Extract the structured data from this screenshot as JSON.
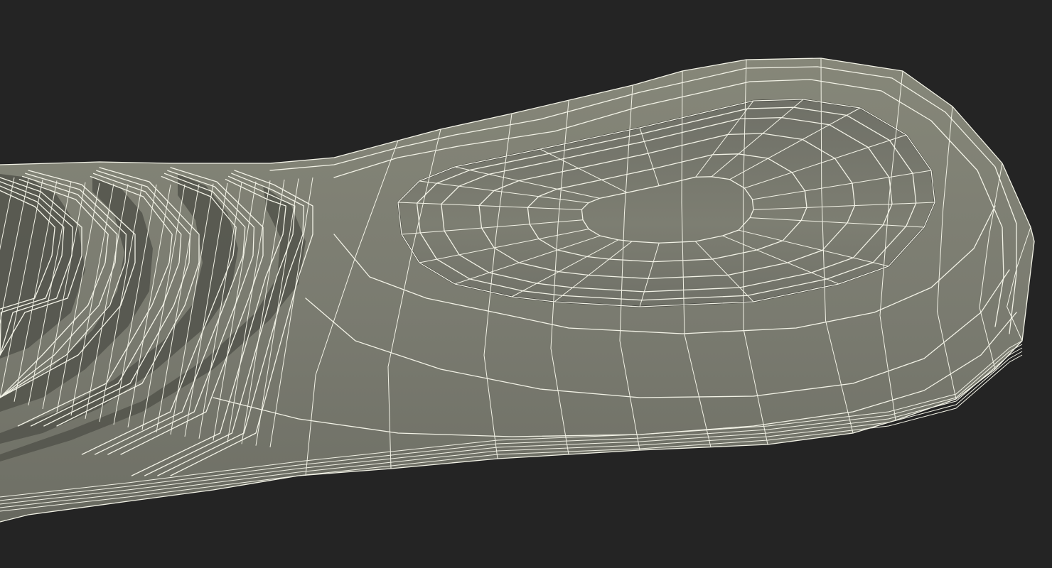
{
  "scene": {
    "background_color": "#242424",
    "surface_color": "#7a7b70",
    "surface_shadow_color": "#5e5f56",
    "surface_highlight_color": "#8a8b80",
    "wire_color": "#f2f2e6"
  }
}
